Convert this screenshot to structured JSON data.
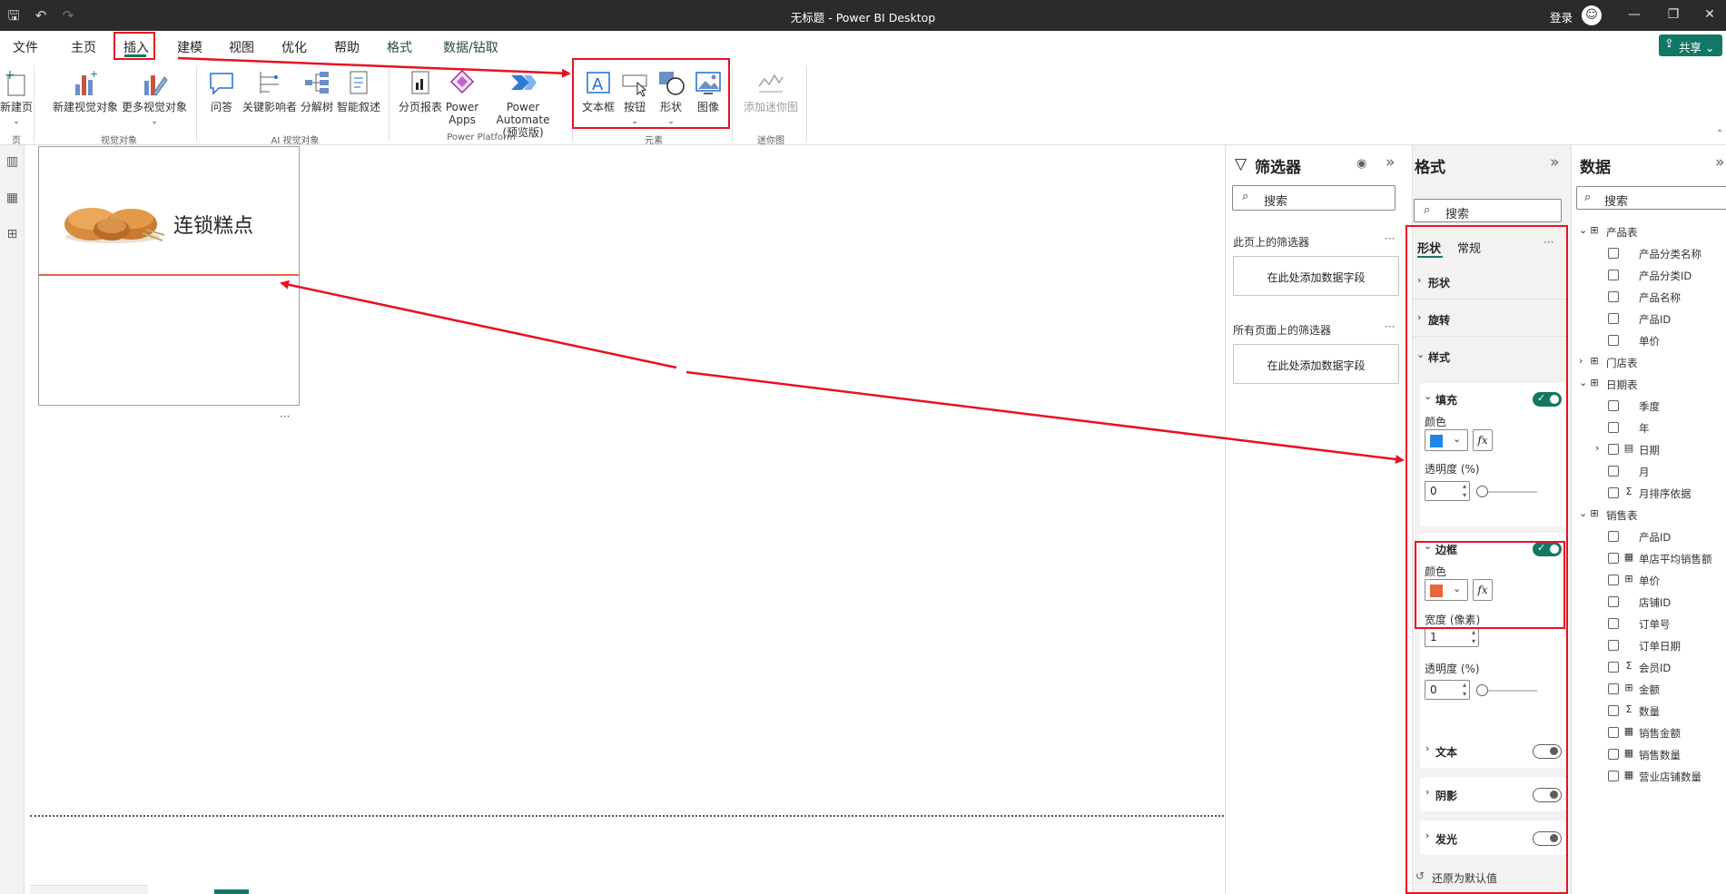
{
  "titlebar": {
    "app_title": "无标题 - Power BI Desktop",
    "login": "登录"
  },
  "menu": {
    "tabs": [
      "文件",
      "主页",
      "插入",
      "建模",
      "视图",
      "优化",
      "帮助",
      "格式",
      "数据/钻取"
    ],
    "active": "插入",
    "share": "共享"
  },
  "ribbon": {
    "buttons": {
      "new_page": "新建页",
      "new_visual": "新建视觉对象",
      "more_visuals": "更多视觉对象",
      "qa": "问答",
      "key_influencers": "关键影响者",
      "decomp_tree": "分解树",
      "smart_narrative": "智能叙述",
      "paginated_report": "分页报表",
      "power_apps_1": "Power",
      "power_apps_2": "Apps",
      "power_automate_1": "Power Automate",
      "power_automate_2": "(预览版)",
      "text_box": "文本框",
      "button": "按钮",
      "shapes": "形状",
      "image": "图像",
      "add_sparkline": "添加迷你图"
    },
    "groups": {
      "pages": "页",
      "visuals": "视觉对象",
      "ai_visuals": "AI 视觉对象",
      "power_platform": "Power Platform",
      "elements": "元素",
      "sparklines": "迷你图"
    }
  },
  "canvas": {
    "shape_title": "连锁糕点",
    "more": "···"
  },
  "filters": {
    "title": "筛选器",
    "search": "搜索",
    "this_page": "此页上的筛选器",
    "all_pages": "所有页面上的筛选器",
    "add_field": "在此处添加数据字段",
    "more": "···"
  },
  "format": {
    "title": "格式",
    "search": "搜索",
    "tabs": {
      "shape": "形状",
      "general": "常规"
    },
    "more": "···",
    "sections": {
      "shape": "形状",
      "rotation": "旋转",
      "style": "样式"
    },
    "fill": {
      "title": "填充",
      "color_label": "颜色",
      "color": "#1e88e5",
      "transparency_label": "透明度 (%)",
      "transparency": "0",
      "enabled": true
    },
    "border": {
      "title": "边框",
      "color_label": "颜色",
      "color": "#e8663d",
      "width_label": "宽度 (像素)",
      "width": "1",
      "transparency_label": "透明度 (%)",
      "transparency": "0",
      "enabled": true
    },
    "text": {
      "title": "文本",
      "enabled": false
    },
    "shadow": {
      "title": "阴影",
      "enabled": false
    },
    "glow": {
      "title": "发光",
      "enabled": false
    },
    "fx": "fx",
    "reset": "还原为默认值"
  },
  "data": {
    "title": "数据",
    "search": "搜索",
    "tables": [
      {
        "name": "产品表",
        "expanded": true,
        "fields": [
          {
            "name": "产品分类名称",
            "type": "text"
          },
          {
            "name": "产品分类ID",
            "type": "text"
          },
          {
            "name": "产品名称",
            "type": "text"
          },
          {
            "name": "产品ID",
            "type": "text"
          },
          {
            "name": "单价",
            "type": "text"
          }
        ]
      },
      {
        "name": "门店表",
        "expanded": false,
        "fields": []
      },
      {
        "name": "日期表",
        "expanded": true,
        "fields": [
          {
            "name": "季度",
            "type": "text"
          },
          {
            "name": "年",
            "type": "text"
          },
          {
            "name": "日期",
            "type": "date"
          },
          {
            "name": "月",
            "type": "text"
          },
          {
            "name": "月排序依据",
            "type": "sum"
          }
        ]
      },
      {
        "name": "销售表",
        "expanded": true,
        "fields": [
          {
            "name": "产品ID",
            "type": "text"
          },
          {
            "name": "单店平均销售额",
            "type": "measure"
          },
          {
            "name": "单价",
            "type": "calc"
          },
          {
            "name": "店铺ID",
            "type": "text"
          },
          {
            "name": "订单号",
            "type": "text"
          },
          {
            "name": "订单日期",
            "type": "text"
          },
          {
            "name": "会员ID",
            "type": "sum"
          },
          {
            "name": "金额",
            "type": "calc"
          },
          {
            "name": "数量",
            "type": "sum"
          },
          {
            "name": "销售金额",
            "type": "measure"
          },
          {
            "name": "销售数量",
            "type": "measure"
          },
          {
            "name": "营业店铺数量",
            "type": "measure"
          }
        ]
      }
    ]
  },
  "annotation_color": "#e81123",
  "accent_color": "#117865"
}
